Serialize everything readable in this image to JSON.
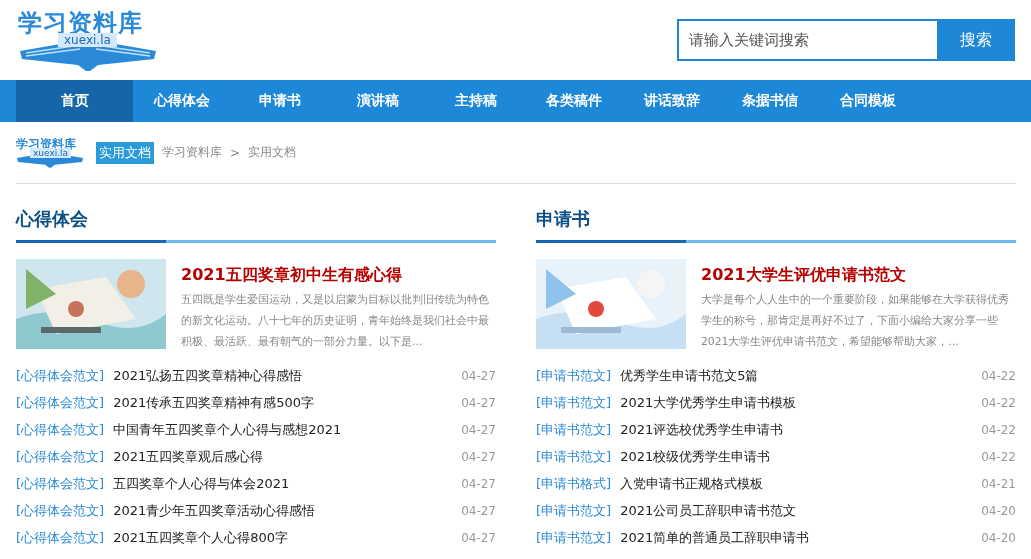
{
  "logo": {
    "title": "学习资料库",
    "domain": "xuexi.la"
  },
  "search": {
    "placeholder": "请输入关键词搜索",
    "button": "搜索"
  },
  "nav": [
    {
      "label": "首页",
      "selected": true
    },
    {
      "label": "心得体会",
      "selected": false
    },
    {
      "label": "申请书",
      "selected": false
    },
    {
      "label": "演讲稿",
      "selected": false
    },
    {
      "label": "主持稿",
      "selected": false
    },
    {
      "label": "各类稿件",
      "selected": false
    },
    {
      "label": "讲话致辞",
      "selected": false
    },
    {
      "label": "条据书信",
      "selected": false
    },
    {
      "label": "合同模板",
      "selected": false
    }
  ],
  "breadcrumb": {
    "logo_title": "学习资料库",
    "logo_domain": "xuexi.la",
    "badge": "实用文档",
    "path": [
      "学习资料库",
      "实用文档"
    ],
    "separator": ">"
  },
  "sections": [
    {
      "title": "心得体会",
      "featured": {
        "kind": "picture",
        "title": "2021五四奖章初中生有感心得",
        "summary": "五四既是学生爱国运动，又是以启蒙为目标以批判旧传统为特色的新文化运动。八十七年的历史证明，青年始终是我们社会中最积极、最活跃、最有朝气的一部分力量。以下是..."
      },
      "items": [
        {
          "tag": "[心得体会范文]",
          "title": "2021弘扬五四奖章精神心得感悟",
          "date": "04-27"
        },
        {
          "tag": "[心得体会范文]",
          "title": "2021传承五四奖章精神有感500字",
          "date": "04-27"
        },
        {
          "tag": "[心得体会范文]",
          "title": "中国青年五四奖章个人心得与感想2021",
          "date": "04-27"
        },
        {
          "tag": "[心得体会范文]",
          "title": "2021五四奖章观后感心得",
          "date": "04-27"
        },
        {
          "tag": "[心得体会范文]",
          "title": "五四奖章个人心得与体会2021",
          "date": "04-27"
        },
        {
          "tag": "[心得体会范文]",
          "title": "2021青少年五四奖章活动心得感悟",
          "date": "04-27"
        },
        {
          "tag": "[心得体会范文]",
          "title": "2021五四奖章个人心得800字",
          "date": "04-27"
        }
      ]
    },
    {
      "title": "申请书",
      "featured": {
        "kind": "picture",
        "title": "2021大学生评优申请书范文",
        "summary": "大学是每个人人生中的一个重要阶段，如果能够在大学获得优秀学生的称号，那肯定是再好不过了，下面小编给大家分享一些2021大学生评优申请书范文，希望能够帮助大家，..."
      },
      "items": [
        {
          "tag": "[申请书范文]",
          "title": "优秀学生申请书范文5篇",
          "date": "04-22"
        },
        {
          "tag": "[申请书范文]",
          "title": "2021大学优秀学生申请书模板",
          "date": "04-22"
        },
        {
          "tag": "[申请书范文]",
          "title": "2021评选校优秀学生申请书",
          "date": "04-22"
        },
        {
          "tag": "[申请书范文]",
          "title": "2021校级优秀学生申请书",
          "date": "04-22"
        },
        {
          "tag": "[申请书格式]",
          "title": "入党申请书正规格式模板",
          "date": "04-21"
        },
        {
          "tag": "[申请书范文]",
          "title": "2021公司员工辞职申请书范文",
          "date": "04-20"
        },
        {
          "tag": "[申请书范文]",
          "title": "2021简单的普通员工辞职申请书",
          "date": "04-20"
        }
      ]
    }
  ]
}
